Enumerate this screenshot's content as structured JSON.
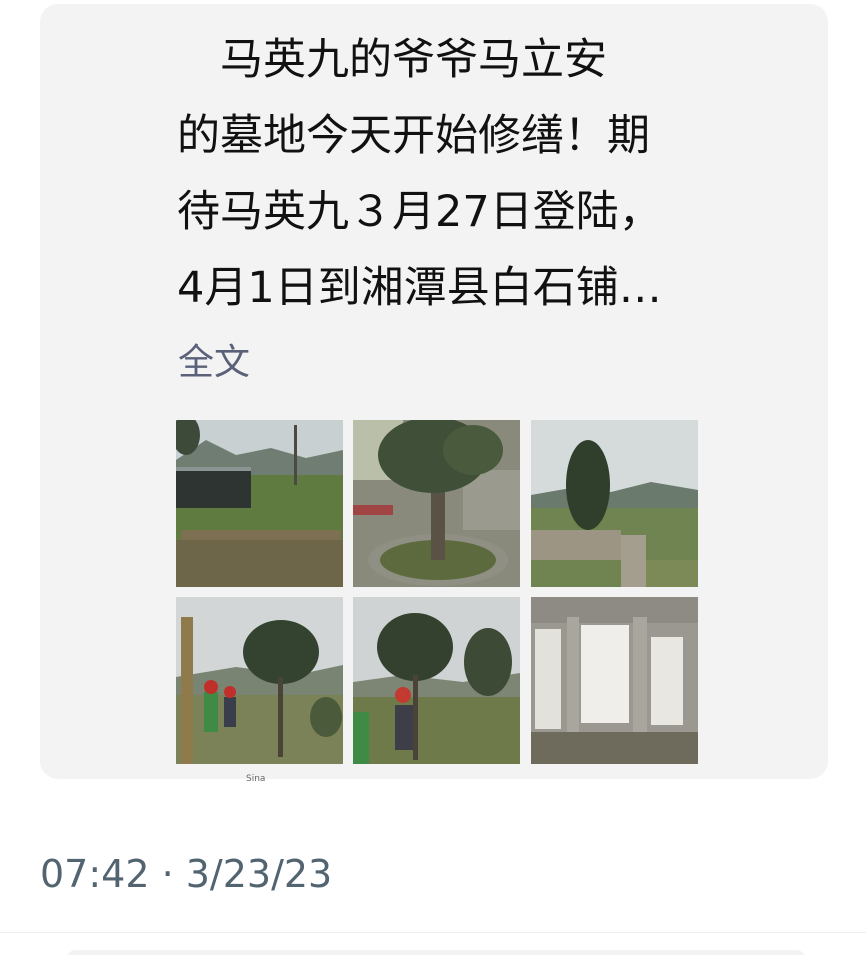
{
  "post": {
    "text": "　马英九的爷爷马立安\n的墓地今天开始修缮！期\n待马英九３月27日登陆，\n4月1日到湘潭县白石铺…",
    "expand_label": "全文",
    "photos": [
      {
        "icon": "photo-hillside-fence"
      },
      {
        "icon": "photo-tree-stone-ring"
      },
      {
        "icon": "photo-cypress-field"
      },
      {
        "icon": "photo-workers-round-tree"
      },
      {
        "icon": "photo-worker-trimming-tree"
      },
      {
        "icon": "photo-stone-wall-panels"
      }
    ],
    "watermark": "Sina"
  },
  "timestamp": "07:42 · 3/23/23",
  "colors": {
    "card_bg": "#f3f3f3",
    "text": "#111111",
    "link": "#5a6178",
    "meta": "#536471"
  }
}
